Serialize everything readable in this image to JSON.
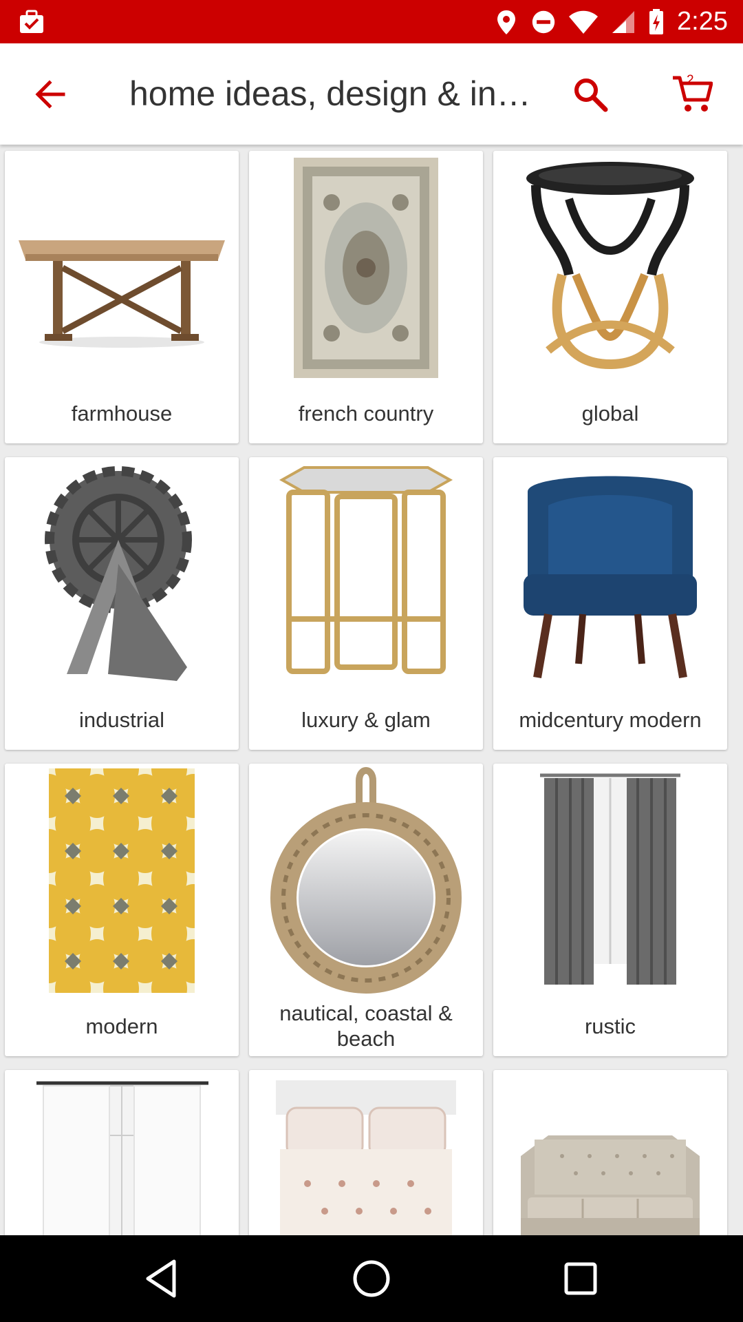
{
  "status_bar": {
    "time": "2:25",
    "icons": [
      "briefcase-check-icon",
      "location-icon",
      "do-not-disturb-icon",
      "wifi-icon",
      "signal-icon",
      "battery-charging-icon"
    ]
  },
  "app_bar": {
    "title": "home ideas, design & inspiration",
    "back_icon": "arrow-back-icon",
    "search_icon": "search-icon",
    "cart_icon": "cart-icon",
    "cart_count": "2"
  },
  "categories": [
    {
      "label": "farmhouse",
      "image": "wood-table"
    },
    {
      "label": "french country",
      "image": "floral-rug"
    },
    {
      "label": "global",
      "image": "rattan-stool"
    },
    {
      "label": "industrial",
      "image": "gear-sculpture"
    },
    {
      "label": "luxury & glam",
      "image": "gold-side-table"
    },
    {
      "label": "midcentury modern",
      "image": "blue-armchair"
    },
    {
      "label": "modern",
      "image": "yellow-pattern-rug"
    },
    {
      "label": "nautical, coastal & beach",
      "image": "rope-mirror"
    },
    {
      "label": "rustic",
      "image": "grey-curtains"
    },
    {
      "label": "",
      "image": "white-curtains"
    },
    {
      "label": "",
      "image": "floral-bedding"
    },
    {
      "label": "",
      "image": "tufted-sofa"
    }
  ],
  "colors": {
    "brand_red": "#cc0000",
    "background": "#ececec",
    "text": "#333333"
  },
  "nav_bar": {
    "icons": [
      "back-triangle-icon",
      "home-circle-icon",
      "recents-square-icon"
    ]
  }
}
